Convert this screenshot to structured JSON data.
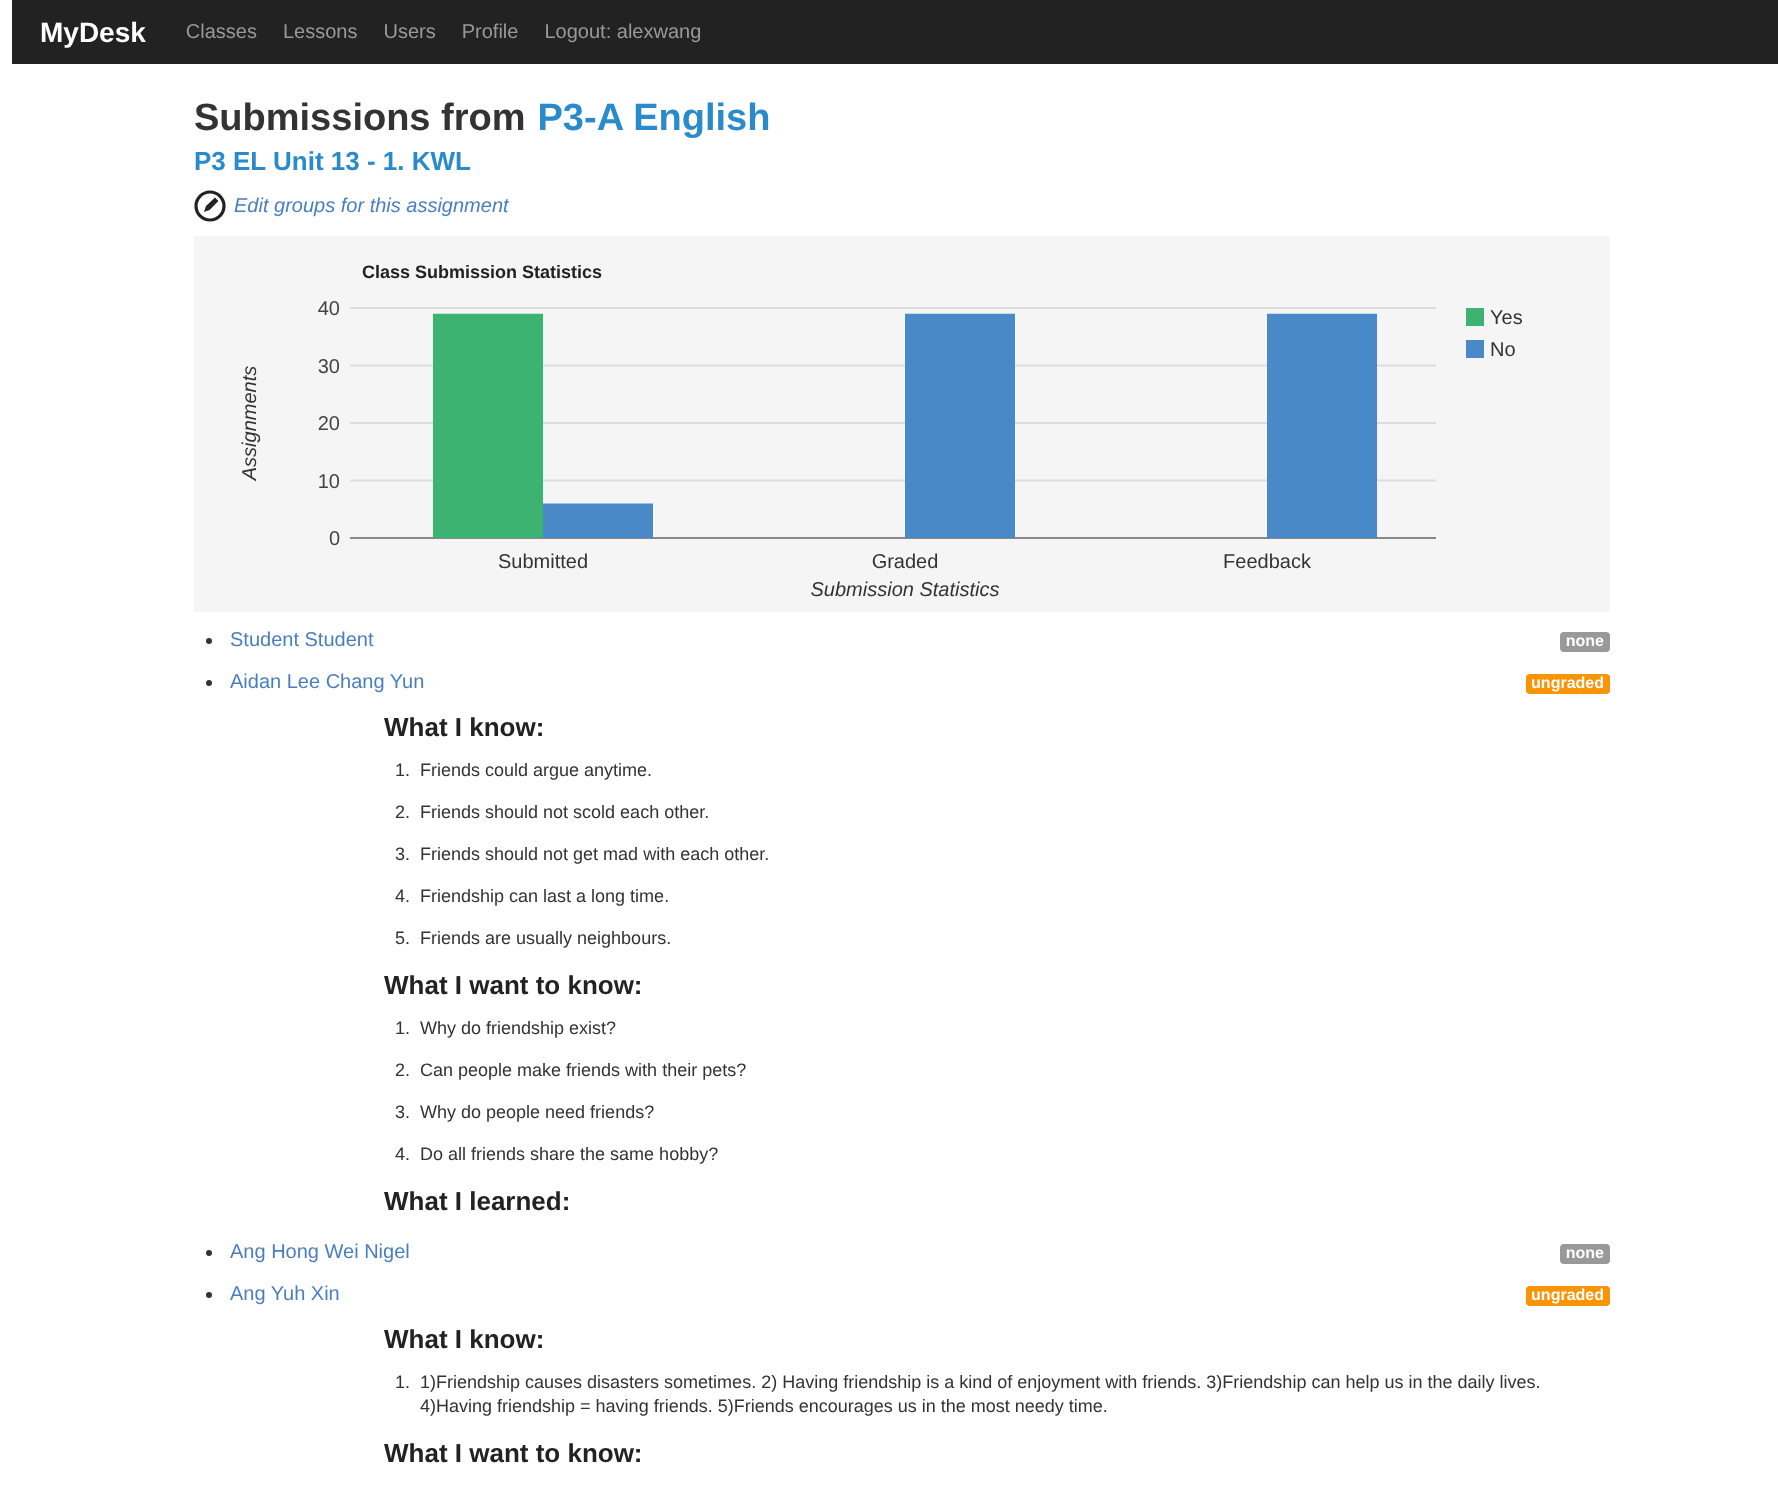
{
  "navbar": {
    "brand": "MyDesk",
    "links": [
      "Classes",
      "Lessons",
      "Users",
      "Profile",
      "Logout: alexwang"
    ]
  },
  "header": {
    "title_prefix": "Submissions from",
    "class_link": "P3-A English",
    "assignment": "P3 EL Unit 13 - 1. KWL",
    "edit_link": "Edit groups for this assignment"
  },
  "chart": {
    "chart_data": {
      "type": "bar",
      "title": "Class Submission Statistics",
      "xlabel": "Submission Statistics",
      "ylabel": "Assignments",
      "categories": [
        "Submitted",
        "Graded",
        "Feedback"
      ],
      "series": [
        {
          "name": "Yes",
          "color": "#3cb371",
          "values": [
            39,
            0,
            0
          ]
        },
        {
          "name": "No",
          "color": "#4a89c8",
          "values": [
            6,
            39,
            39
          ]
        }
      ],
      "ylim": [
        0,
        40
      ],
      "yticks": [
        0,
        10,
        20,
        30,
        40
      ],
      "grid": true,
      "legend": true
    }
  },
  "students": [
    {
      "name": "Student Student",
      "badge": {
        "label": "none",
        "kind": "none"
      }
    },
    {
      "name": "Aidan Lee Chang Yun",
      "badge": {
        "label": "ungraded",
        "kind": "ungraded"
      },
      "sections": [
        {
          "heading": "What I know:",
          "items": [
            {
              "number": "1.",
              "text": "Friends could argue anytime."
            },
            {
              "number": "2.",
              "text": "Friends should not scold each other."
            },
            {
              "number": "3.",
              "text": "Friends should not get mad with each other."
            },
            {
              "number": "4.",
              "text": "Friendship can last a long time."
            },
            {
              "number": "5.",
              "text": "Friends are usually neighbours."
            }
          ]
        },
        {
          "heading": "What I want to know:",
          "items": [
            {
              "number": "1.",
              "text": "Why do friendship exist?"
            },
            {
              "number": "2.",
              "text": "Can people make friends with their pets?"
            },
            {
              "number": "3.",
              "text": "Why do people need friends?"
            },
            {
              "number": "4.",
              "text": "Do all friends share the same hobby?"
            }
          ]
        },
        {
          "heading": "What I learned:"
        }
      ]
    },
    {
      "name": "Ang Hong Wei Nigel",
      "badge": {
        "label": "none",
        "kind": "none"
      }
    },
    {
      "name": "Ang Yuh Xin",
      "badge": {
        "label": "ungraded",
        "kind": "ungraded"
      },
      "sections": [
        {
          "heading": "What I know:",
          "items": [
            {
              "number": "1.",
              "text": "1)Friendship causes disasters sometimes. 2) Having friendship is a kind of enjoyment with friends. 3)Friendship can help us in the daily lives. 4)Having friendship = having friends. 5)Friends encourages us in the most needy time."
            }
          ]
        },
        {
          "heading": "What I want to know:"
        }
      ]
    }
  ]
}
